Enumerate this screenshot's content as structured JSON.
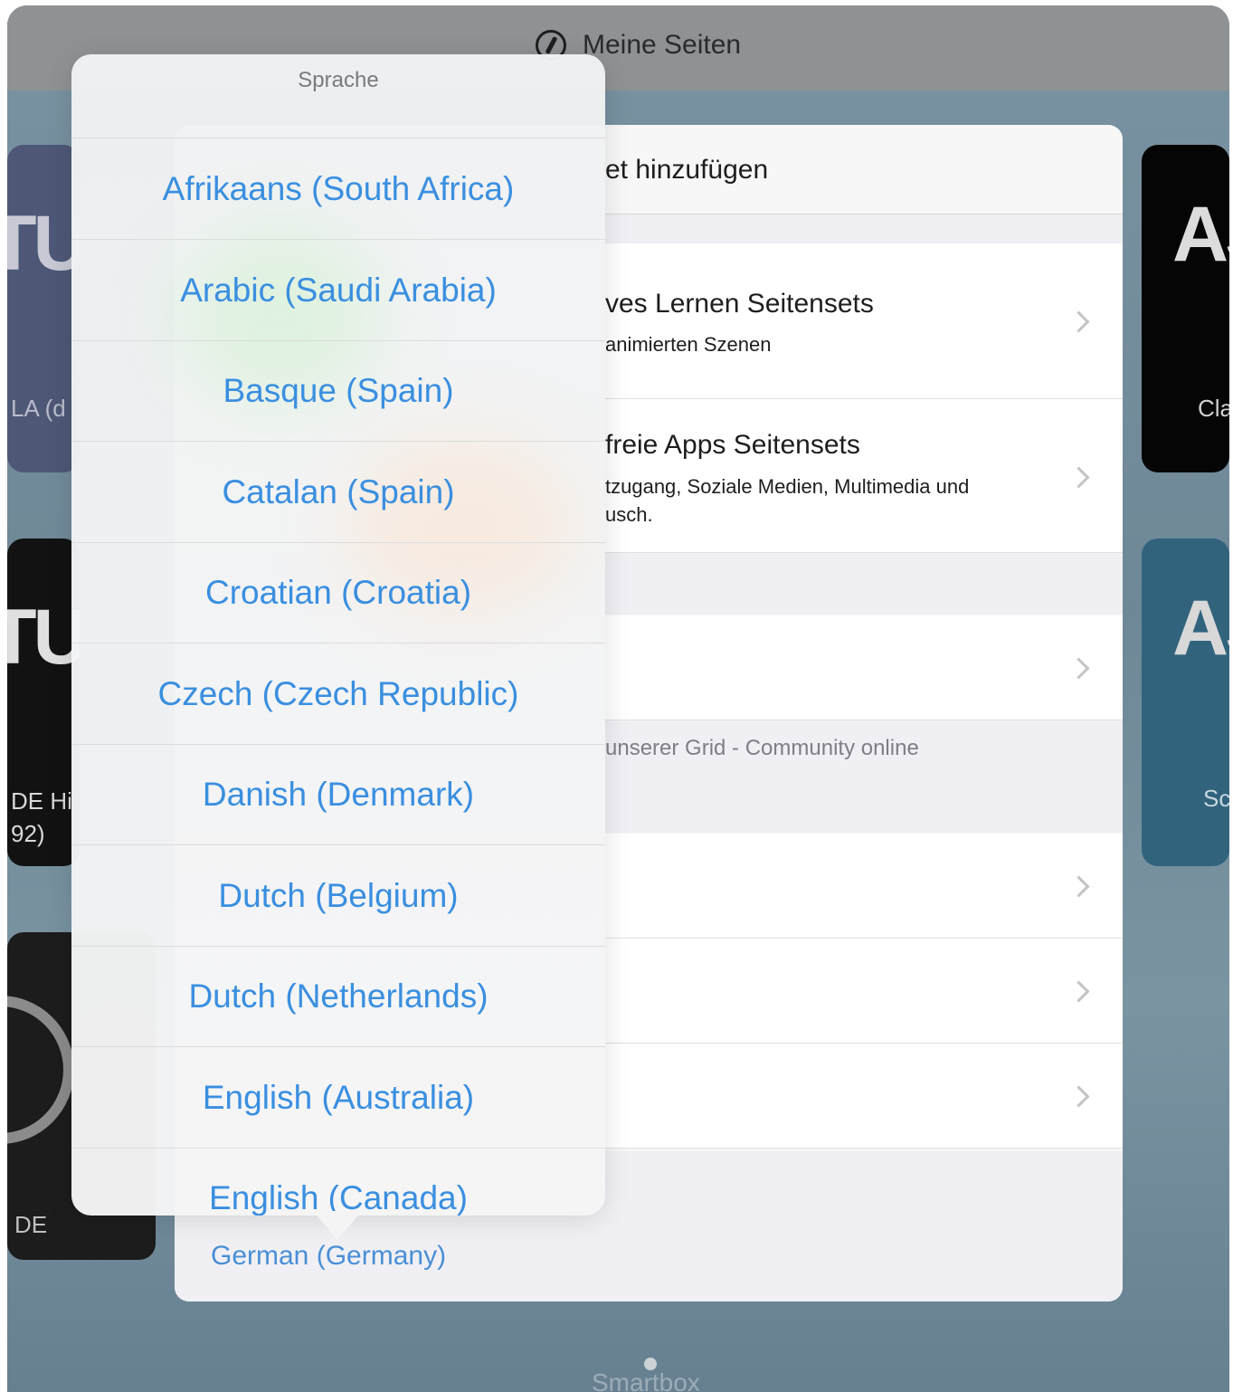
{
  "navbar": {
    "title": "Meine Seiten"
  },
  "background_tiles": [
    {
      "big": "TU",
      "caption": "LA (d"
    },
    {
      "big": "TU",
      "caption": "DE Hi\n92)"
    },
    {
      "big": "",
      "caption": "DE"
    },
    {
      "big": "AS",
      "caption": "Cla"
    },
    {
      "big": "AS",
      "caption": "Sc"
    }
  ],
  "sheet": {
    "title": "et hinzufügen",
    "rows": [
      {
        "title": "ves Lernen Seitensets",
        "subtitle": "animierten Szenen"
      },
      {
        "title": "freie Apps Seitensets",
        "subtitle": "tzugang, Soziale Medien, Multimedia und\nusch."
      }
    ],
    "community_note": "unserer Grid - Community online",
    "language_value": "German (Germany)"
  },
  "popover": {
    "title": "Sprache",
    "options": [
      "Afrikaans (South Africa)",
      "Arabic (Saudi Arabia)",
      "Basque (Spain)",
      "Catalan (Spain)",
      "Croatian (Croatia)",
      "Czech (Czech Republic)",
      "Danish (Denmark)",
      "Dutch (Belgium)",
      "Dutch (Netherlands)",
      "English (Australia)",
      "English (Canada)"
    ]
  },
  "footer": {
    "watermark": "Smartbox"
  },
  "colors": {
    "accent": "#3a8fe0",
    "navbar": "#8f9294",
    "background": "#6c8594"
  }
}
